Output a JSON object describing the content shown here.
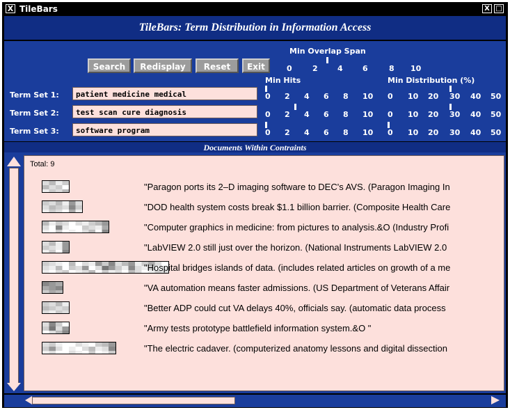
{
  "window": {
    "title": "TileBars",
    "close_glyph": "X",
    "maximize_glyph": "□"
  },
  "header": {
    "title": "TileBars: Term Distribution in Information Access"
  },
  "toolbar": {
    "search": "Search",
    "redisplay": "Redisplay",
    "reset": "Reset",
    "exit": "Exit"
  },
  "min_overlap_span": {
    "label": "Min Overlap Span",
    "ticks": [
      "0",
      "2",
      "4",
      "6",
      "8",
      "10"
    ]
  },
  "min_hits": {
    "label": "Min Hits",
    "ticks": [
      "0",
      "2",
      "4",
      "6",
      "8",
      "10"
    ]
  },
  "min_distribution": {
    "label": "Min Distribution (%)",
    "ticks": [
      "0",
      "10",
      "20",
      "30",
      "40",
      "50"
    ]
  },
  "term_sets": [
    {
      "label": "Term Set 1:",
      "value": "patient medicine medical",
      "min_hits": 0,
      "min_distribution": 30
    },
    {
      "label": "Term Set 2:",
      "value": "test scan cure diagnosis",
      "min_hits": 3,
      "min_distribution": 30
    },
    {
      "label": "Term Set 3:",
      "value": "software program",
      "min_hits": 0,
      "min_distribution": 0
    }
  ],
  "overlap_span_value": 3,
  "results": {
    "header": "Documents Within Contraints",
    "total": "Total: 9",
    "documents": [
      {
        "title": "\"Paragon ports its 2–D imaging software to DEC's AVS. (Paragon Imaging In"
      },
      {
        "title": "\"DOD health system costs break $1.1 billion barrier. (Composite Health Care"
      },
      {
        "title": "\"Computer graphics in medicine: from pictures to analysis.&O  (Industry Profi"
      },
      {
        "title": "\"LabVIEW 2.0 still just over the horizon. (National Instruments LabVIEW 2.0"
      },
      {
        "title": "\"Hospital bridges islands of data. (includes related articles on growth of a me"
      },
      {
        "title": "\"VA automation means faster admissions. (US Department of Veterans Affair"
      },
      {
        "title": "\"Better ADP could cut VA delays 40%, officials say. (automatic data process"
      },
      {
        "title": "\"Army tests prototype battlefield information system.&O \""
      },
      {
        "title": "\"The electric cadaver. (computerized anatomy lessons and digital dissection"
      }
    ]
  },
  "tilebars": [
    {
      "segments": 4,
      "shades": [
        [
          "#ddd",
          "#bbb",
          "#eee",
          "#ccc"
        ],
        [
          "#bbb",
          "#ddd",
          "#ccc",
          "#fff"
        ],
        [
          "#eee",
          "#ccc",
          "#ddd",
          "#bbb"
        ]
      ]
    },
    {
      "segments": 6,
      "shades": [
        [
          "#ccc",
          "#ddd",
          "#bbb",
          "#eee",
          "#999",
          "#ddd"
        ],
        [
          "#ddd",
          "#bbb",
          "#ccc",
          "#ddd",
          "#888",
          "#ccc"
        ],
        [
          "#eee",
          "#ccc",
          "#ddd",
          "#fff",
          "#aaa",
          "#eee"
        ]
      ]
    },
    {
      "segments": 10,
      "shades": [
        [
          "#bbb",
          "#eee",
          "#ccc",
          "#ddd",
          "#fff",
          "#ddd",
          "#eee",
          "#ccc",
          "#bbb",
          "#999"
        ],
        [
          "#ddd",
          "#fff",
          "#888",
          "#eee",
          "#fff",
          "#fff",
          "#ccc",
          "#ddd",
          "#eee",
          "#aaa"
        ],
        [
          "#eee",
          "#fff",
          "#ccc",
          "#fff",
          "#eee",
          "#fff",
          "#ddd",
          "#bbb",
          "#fff",
          "#888"
        ]
      ]
    },
    {
      "segments": 4,
      "shades": [
        [
          "#ddd",
          "#bbb",
          "#eee",
          "#999"
        ],
        [
          "#ccc",
          "#ddd",
          "#eee",
          "#999"
        ],
        [
          "#eee",
          "#ccc",
          "#fff",
          "#888"
        ]
      ]
    },
    {
      "segments": 19,
      "shades": [
        [
          "#ccc",
          "#ddd",
          "#eee",
          "#fff",
          "#bbb",
          "#fff",
          "#ddd",
          "#eee",
          "#999",
          "#ccc",
          "#888",
          "#ddd",
          "#bbb",
          "#999",
          "#eee",
          "#ccc",
          "#aaa",
          "#ddd",
          "#fff"
        ],
        [
          "#ddd",
          "#eee",
          "#bbb",
          "#fff",
          "#ccc",
          "#ddd",
          "#999",
          "#fff",
          "#ddd",
          "#777",
          "#999",
          "#ccc",
          "#eee",
          "#888",
          "#ddd",
          "#eee",
          "#ccc",
          "#fff",
          "#eee"
        ],
        [
          "#eee",
          "#fff",
          "#ddd",
          "#ccc",
          "#fff",
          "#eee",
          "#ddd",
          "#bbb",
          "#fff",
          "#ccc",
          "#eee",
          "#ddd",
          "#fff",
          "#bbb",
          "#ddd",
          "#fff",
          "#eee",
          "#ccc",
          "#ddd"
        ]
      ]
    },
    {
      "segments": 3,
      "shades": [
        [
          "#888",
          "#999",
          "#aaa"
        ],
        [
          "#aaa",
          "#999",
          "#888"
        ],
        [
          "#ccc",
          "#aaa",
          "#bbb"
        ]
      ]
    },
    {
      "segments": 4,
      "shades": [
        [
          "#ccc",
          "#ddd",
          "#bbb",
          "#eee"
        ],
        [
          "#bbb",
          "#ccc",
          "#ddd",
          "#ccc"
        ],
        [
          "#ddd",
          "#eee",
          "#ccc",
          "#ddd"
        ]
      ]
    },
    {
      "segments": 4,
      "shades": [
        [
          "#ddd",
          "#888",
          "#ccc",
          "#fff"
        ],
        [
          "#ccc",
          "#777",
          "#ddd",
          "#999"
        ],
        [
          "#fff",
          "#ddd",
          "#bbb",
          "#888"
        ]
      ]
    },
    {
      "segments": 11,
      "shades": [
        [
          "#ddd",
          "#ccc",
          "#eee",
          "#fff",
          "#fff",
          "#ddd",
          "#eee",
          "#fff",
          "#ccc",
          "#bbb",
          "#999"
        ],
        [
          "#ccc",
          "#999",
          "#ddd",
          "#fff",
          "#eee",
          "#fff",
          "#ddd",
          "#bbb",
          "#eee",
          "#ddd",
          "#888"
        ],
        [
          "#eee",
          "#ddd",
          "#fff",
          "#fff",
          "#ddd",
          "#eee",
          "#fff",
          "#ccc",
          "#fff",
          "#eee",
          "#ccc"
        ]
      ]
    }
  ]
}
